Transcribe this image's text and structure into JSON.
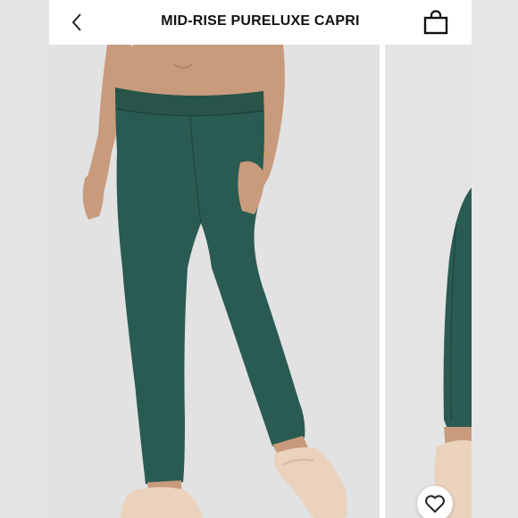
{
  "header": {
    "title": "MID-RISE PURELUXE CAPRI",
    "back_icon": "chevron-left-icon",
    "bag_icon": "shopping-bag-icon"
  },
  "gallery": {
    "favorite_icon": "heart-icon"
  },
  "colors": {
    "product": "#2a5b52",
    "skin": "#c89b7c",
    "sneaker": "#ead2bc",
    "background": "#e2e2e3"
  }
}
